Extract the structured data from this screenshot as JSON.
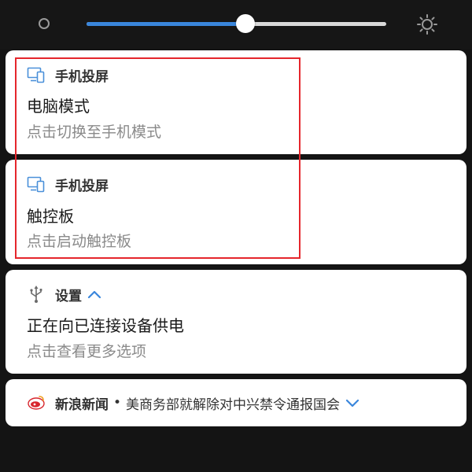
{
  "brightness": {
    "level": 0.53,
    "accent_color": "#3a86dc",
    "low_icon": "brightness-low-icon",
    "high_icon": "brightness-high-icon"
  },
  "notifications": [
    {
      "app": "手机投屏",
      "icon": "cast-screen-icon",
      "title": "电脑模式",
      "subtitle": "点击切换至手机模式"
    },
    {
      "app": "手机投屏",
      "icon": "cast-screen-icon",
      "title": "触控板",
      "subtitle": "点击启动触控板"
    },
    {
      "app": "设置",
      "icon": "usb-icon",
      "expand_icon": "chevron-up-icon",
      "title": "正在向已连接设备供电",
      "subtitle": "点击查看更多选项"
    },
    {
      "app": "新浪新闻",
      "icon": "sina-news-icon",
      "separator": "•",
      "headline": "美商务部就解除对中兴禁令通报国会",
      "expand_icon": "chevron-down-icon"
    }
  ],
  "highlight_color": "#e5262c"
}
